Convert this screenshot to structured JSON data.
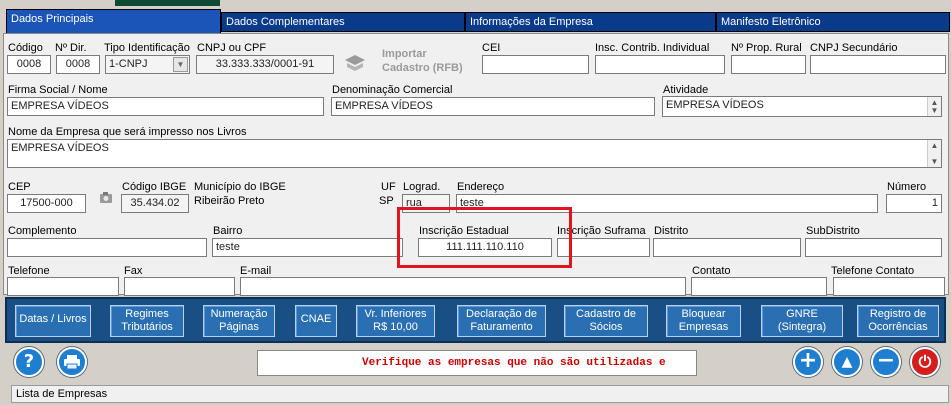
{
  "tabs": [
    {
      "label": "Dados Principais",
      "underline": "P"
    },
    {
      "label": "Dados Complementares",
      "underline": "o"
    },
    {
      "label": "Informações da Empresa",
      "underline": "f"
    },
    {
      "label": "Manifesto Eletrônico",
      "underline": ""
    }
  ],
  "fields": {
    "codigo": {
      "label": "Código",
      "value": "0008"
    },
    "num_dir": {
      "label": "Nº Dir.",
      "value": "0008"
    },
    "tipo_id": {
      "label": "Tipo Identificação",
      "value": "1-CNPJ"
    },
    "cnpj_cpf": {
      "label": "CNPJ ou CPF",
      "value": "33.333.333/0001-91"
    },
    "importar": {
      "label_line1": "Importar",
      "label_line2": "Cadastro (RFB)"
    },
    "cei": {
      "label": "CEI",
      "value": ""
    },
    "insc_contrib": {
      "label": "Insc. Contrib. Individual",
      "value": ""
    },
    "prop_rural": {
      "label": "Nº Prop. Rural",
      "value": ""
    },
    "cnpj_sec": {
      "label": "CNPJ Secundário",
      "value": ""
    },
    "firma": {
      "label": "Firma Social / Nome",
      "value": "EMPRESA VÍDEOS"
    },
    "denominacao": {
      "label": "Denominação Comercial",
      "value": "EMPRESA VÍDEOS"
    },
    "atividade": {
      "label": "Atividade",
      "value": "EMPRESA VÍDEOS"
    },
    "nome_livros": {
      "label": "Nome da Empresa que será impresso nos Livros",
      "value": "EMPRESA VÍDEOS"
    },
    "cep": {
      "label": "CEP",
      "value": "17500-000"
    },
    "cod_ibge": {
      "label": "Código IBGE",
      "value": "35.434.02"
    },
    "municipio": {
      "label": "Município do IBGE",
      "value": "Ribeirão Preto"
    },
    "uf": {
      "label": "UF",
      "value": "SP"
    },
    "lograd": {
      "label": "Lograd.",
      "value": "rua"
    },
    "endereco": {
      "label": "Endereço",
      "value": "teste"
    },
    "numero": {
      "label": "Número",
      "value": "1"
    },
    "complemento": {
      "label": "Complemento",
      "value": ""
    },
    "bairro": {
      "label": "Bairro",
      "value": "teste"
    },
    "insc_estadual": {
      "label": "Inscrição Estadual",
      "value": "111.111.110.110"
    },
    "insc_suframa": {
      "label": "Inscrição Suframa",
      "value": ""
    },
    "distrito": {
      "label": "Distrito",
      "value": ""
    },
    "subdistrito": {
      "label": "SubDistrito",
      "value": ""
    },
    "telefone": {
      "label": "Telefone",
      "value": ""
    },
    "fax": {
      "label": "Fax",
      "value": ""
    },
    "email": {
      "label": "E-mail",
      "value": ""
    },
    "contato": {
      "label": "Contato",
      "value": ""
    },
    "tel_contato": {
      "label": "Telefone Contato",
      "value": ""
    }
  },
  "buttons": [
    {
      "line1": "Datas / Livros",
      "line2": ""
    },
    {
      "line1": "Regimes",
      "line2": "Tributários"
    },
    {
      "line1": "Numeração",
      "line2": "Páginas"
    },
    {
      "line1": "CNAE",
      "line2": ""
    },
    {
      "line1": "Vr. Inferiores",
      "line2": "R$ 10,00"
    },
    {
      "line1": "Declaração de",
      "line2": "Faturamento"
    },
    {
      "line1": "Cadastro de",
      "line2": "Sócios"
    },
    {
      "line1": "Bloquear",
      "line2": "Empresas"
    },
    {
      "line1": "GNRE",
      "line2": "(Sintegra)"
    },
    {
      "line1": "Registro de",
      "line2": "Ocorrências"
    }
  ],
  "message": "Verifique as empresas que não são utilizadas e",
  "status": "Lista de Empresas",
  "colors": {
    "tab_bg": "#0a3a8a",
    "action_bg": "#2a6fb2",
    "message": "#cc0000",
    "highlight": "#e0141e"
  },
  "icons": [
    "help-icon",
    "print-icon",
    "add-icon",
    "up-arrow-icon",
    "remove-icon",
    "power-icon",
    "import-rfb-icon",
    "ibge-lookup-icon"
  ]
}
